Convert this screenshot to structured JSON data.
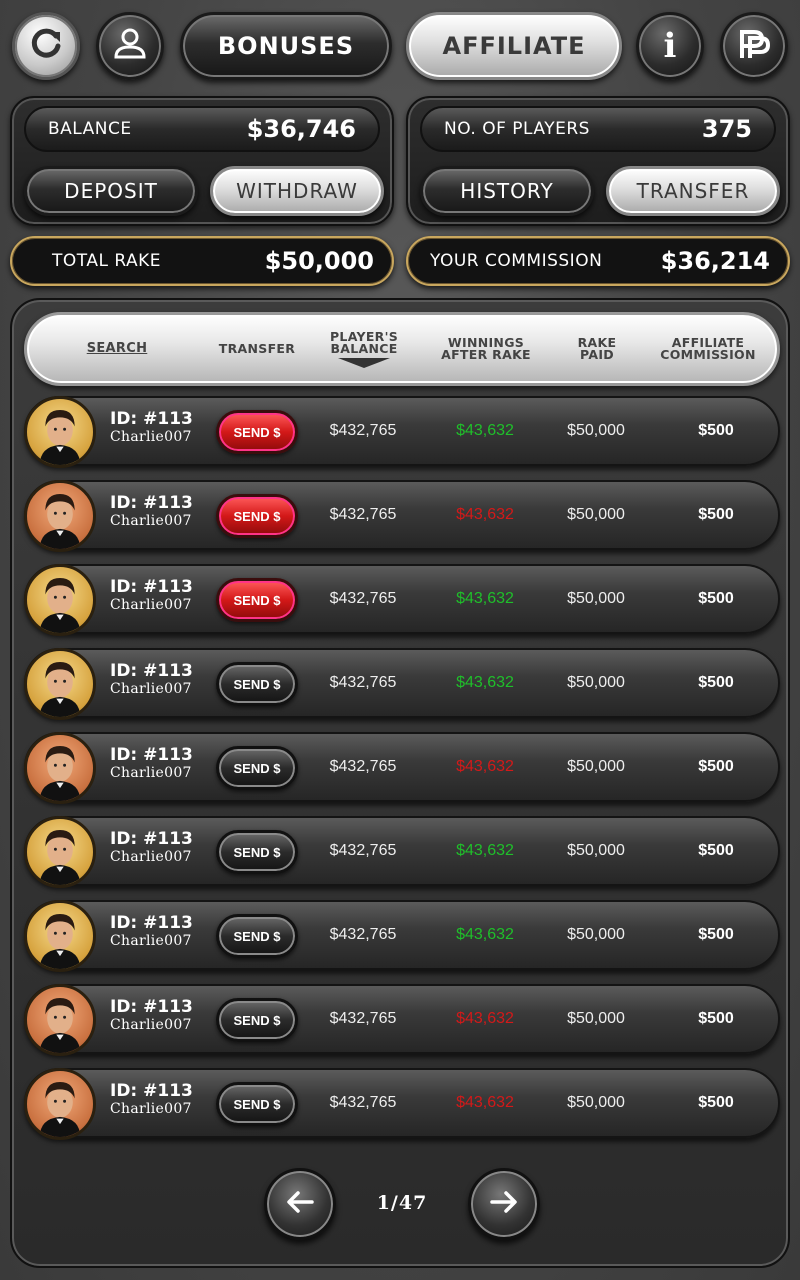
{
  "nav": {
    "refresh_icon": "refresh-icon",
    "profile_icon": "user-icon",
    "bonuses_label": "BONUSES",
    "affiliate_label": "AFFILIATE",
    "info_icon": "info-icon",
    "logo_icon": "pp-logo-icon"
  },
  "balance_panel": {
    "label": "BALANCE",
    "value": "$36,746",
    "deposit_label": "DEPOSIT",
    "withdraw_label": "WITHDRAW"
  },
  "players_panel": {
    "label": "NO. OF PLAYERS",
    "value": "375",
    "history_label": "HISTORY",
    "transfer_label": "TRANSFER"
  },
  "summary": {
    "rake_label": "TOTAL RAKE",
    "rake_value": "$50,000",
    "commission_label": "YOUR COMMISSION",
    "commission_value": "$36,214"
  },
  "table": {
    "headers": {
      "search": "SEARCH",
      "transfer": "TRANSFER",
      "balance_line1": "PLAYER'S",
      "balance_line2": "BALANCE",
      "winnings_line1": "WINNINGS",
      "winnings_line2": "AFTER RAKE",
      "rake_line1": "RAKE",
      "rake_line2": "PAID",
      "commission_line1": "AFFILIATE",
      "commission_line2": "COMMISSION"
    },
    "sorted_by": "PLAYER'S BALANCE",
    "rows": [
      {
        "id": "ID: #113",
        "name": "Charlie007",
        "send": "SEND $",
        "send_style": "red",
        "avatar": "gold",
        "balance": "$432,765",
        "winnings": "$43,632",
        "winnings_sign": "pos",
        "rake": "$50,000",
        "commission": "$500"
      },
      {
        "id": "ID: #113",
        "name": "Charlie007",
        "send": "SEND $",
        "send_style": "red",
        "avatar": "copper",
        "balance": "$432,765",
        "winnings": "$43,632",
        "winnings_sign": "neg",
        "rake": "$50,000",
        "commission": "$500"
      },
      {
        "id": "ID: #113",
        "name": "Charlie007",
        "send": "SEND $",
        "send_style": "red",
        "avatar": "gold",
        "balance": "$432,765",
        "winnings": "$43,632",
        "winnings_sign": "pos",
        "rake": "$50,000",
        "commission": "$500"
      },
      {
        "id": "ID: #113",
        "name": "Charlie007",
        "send": "SEND $",
        "send_style": "dark",
        "avatar": "gold",
        "balance": "$432,765",
        "winnings": "$43,632",
        "winnings_sign": "pos",
        "rake": "$50,000",
        "commission": "$500"
      },
      {
        "id": "ID: #113",
        "name": "Charlie007",
        "send": "SEND $",
        "send_style": "dark",
        "avatar": "copper",
        "balance": "$432,765",
        "winnings": "$43,632",
        "winnings_sign": "neg",
        "rake": "$50,000",
        "commission": "$500"
      },
      {
        "id": "ID: #113",
        "name": "Charlie007",
        "send": "SEND $",
        "send_style": "dark",
        "avatar": "gold",
        "balance": "$432,765",
        "winnings": "$43,632",
        "winnings_sign": "pos",
        "rake": "$50,000",
        "commission": "$500"
      },
      {
        "id": "ID: #113",
        "name": "Charlie007",
        "send": "SEND $",
        "send_style": "dark",
        "avatar": "gold",
        "balance": "$432,765",
        "winnings": "$43,632",
        "winnings_sign": "pos",
        "rake": "$50,000",
        "commission": "$500"
      },
      {
        "id": "ID: #113",
        "name": "Charlie007",
        "send": "SEND $",
        "send_style": "dark",
        "avatar": "copper",
        "balance": "$432,765",
        "winnings": "$43,632",
        "winnings_sign": "neg",
        "rake": "$50,000",
        "commission": "$500"
      },
      {
        "id": "ID: #113",
        "name": "Charlie007",
        "send": "SEND $",
        "send_style": "dark",
        "avatar": "copper",
        "balance": "$432,765",
        "winnings": "$43,632",
        "winnings_sign": "neg",
        "rake": "$50,000",
        "commission": "$500"
      }
    ]
  },
  "pagination": {
    "prev_icon": "arrow-left-icon",
    "next_icon": "arrow-right-icon",
    "page_text": "1/47"
  },
  "colors": {
    "positive": "#1fbf2a",
    "negative": "#d31919",
    "gold_border": "#c9a75e",
    "send_red": "#d31818"
  }
}
